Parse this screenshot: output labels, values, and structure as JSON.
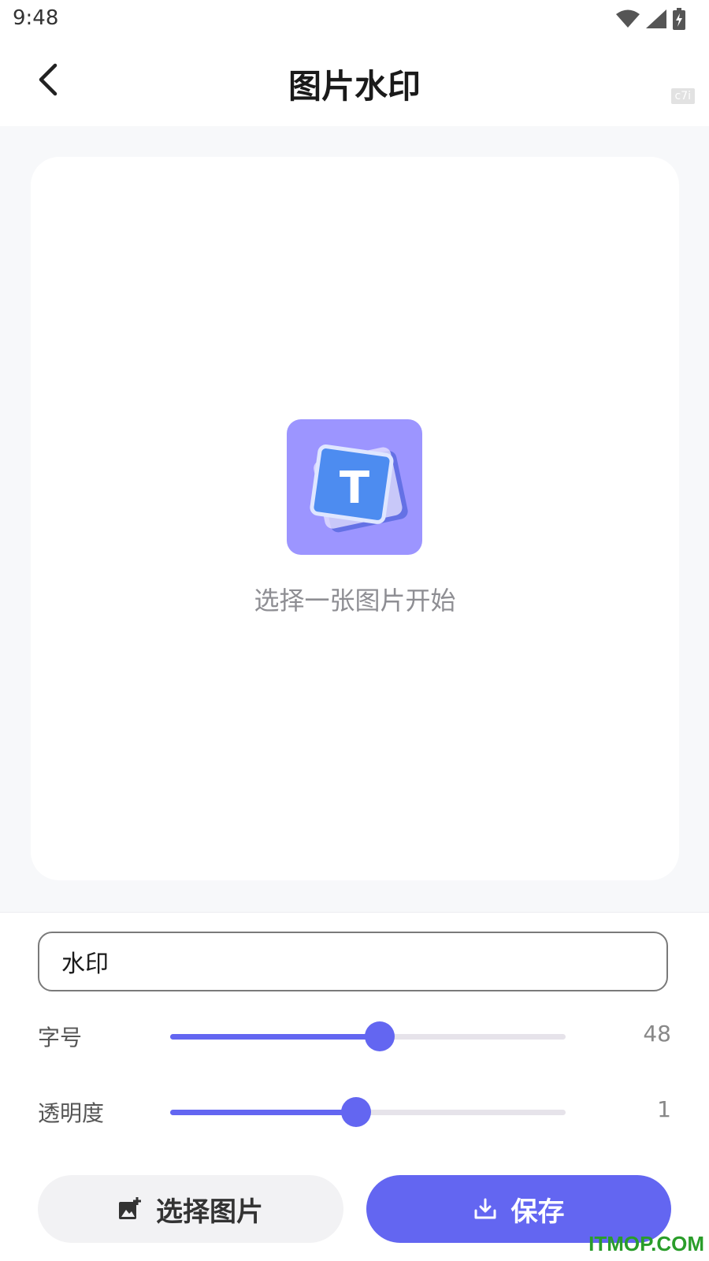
{
  "status_bar": {
    "time": "9:48"
  },
  "corner_tag": "c7i",
  "header": {
    "title": "图片水印"
  },
  "preview": {
    "hint": "选择一张图片开始",
    "logo_letter": "T"
  },
  "watermark_input": {
    "value": "水印"
  },
  "sliders": [
    {
      "label": "字号",
      "value": "48",
      "fraction": 0.53
    },
    {
      "label": "透明度",
      "value": "1",
      "fraction": 0.47
    }
  ],
  "buttons": {
    "pick_label": "选择图片",
    "save_label": "保存"
  },
  "site_watermark": "ITMOP.COM",
  "colors": {
    "accent": "#6366f1",
    "logo_bg": "#9c95ff",
    "card": "#ffffff",
    "page": "#f7f8fa"
  }
}
